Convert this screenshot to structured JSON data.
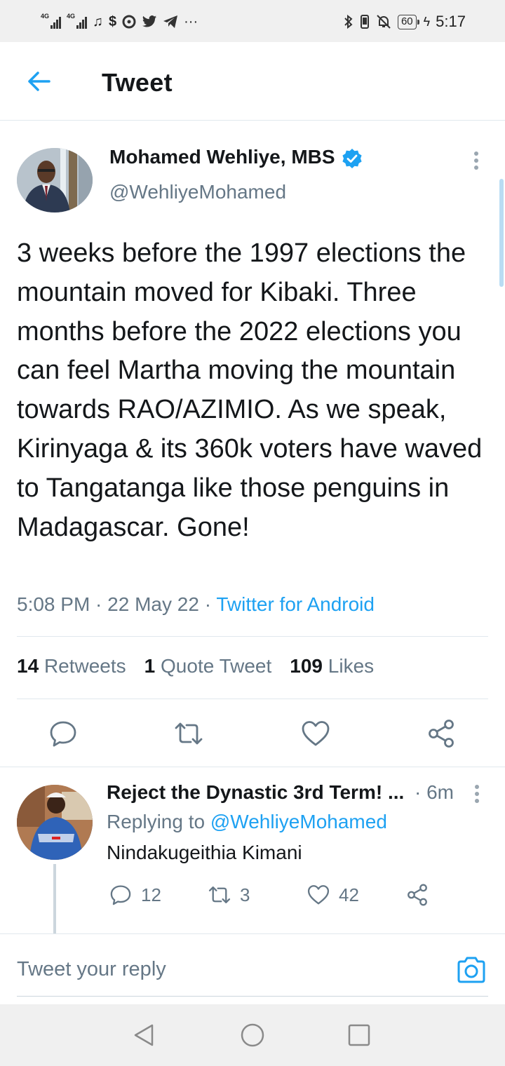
{
  "status_bar": {
    "network_left_1": "4G",
    "network_left_2": "4G",
    "notification_icons": [
      "music-icon",
      "dollar-icon",
      "app-icon",
      "twitter-icon",
      "telegram-icon",
      "more-dots-icon"
    ],
    "battery_level": "60",
    "time": "5:17"
  },
  "header": {
    "title": "Tweet"
  },
  "tweet": {
    "author_name": "Mohamed Wehliye, MBS",
    "handle": "@WehliyeMohamed",
    "text": "3 weeks before the 1997 elections the mountain moved for Kibaki. Three months before the 2022 elections you can feel Martha moving the mountain towards RAO/AZIMIO. As we speak, Kirinyaga & its 360k voters have waved to Tangatanga like those penguins in Madagascar. Gone!",
    "time": "5:08 PM",
    "sep1": " · ",
    "date": "22 May 22",
    "sep2": " · ",
    "source": "Twitter for Android",
    "retweets_count": "14",
    "retweets_label": "Retweets",
    "quotes_count": "1",
    "quotes_label": "Quote Tweet",
    "likes_count": "109",
    "likes_label": "Likes"
  },
  "reply": {
    "author_name": "Reject the Dynastic 3rd Term! ...",
    "time": "· 6m",
    "replying_prefix": "Replying to ",
    "replying_handle": "@WehliyeMohamed",
    "text": "Nindakugeithia Kimani",
    "reply_count": "12",
    "retweet_count": "3",
    "like_count": "42"
  },
  "compose": {
    "placeholder": "Tweet your reply"
  },
  "colors": {
    "accent": "#1da1f2",
    "secondary_text": "#657786",
    "divider": "#e1e8ed"
  }
}
